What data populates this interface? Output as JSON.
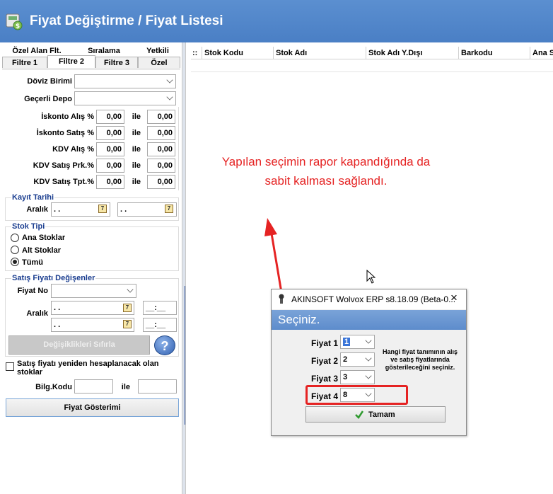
{
  "window": {
    "title": "Fiyat Değiştirme / Fiyat Listesi"
  },
  "left_panel": {
    "tabs_row1": [
      "Özel Alan Flt.",
      "Sıralama",
      "Yetkili"
    ],
    "tabs_row2": [
      "Filtre 1",
      "Filtre 2",
      "Filtre 3",
      "Özel"
    ],
    "active_tab": "Filtre 2",
    "doviz_birimi_label": "Döviz Birimi",
    "gecerli_depo_label": "Geçerli Depo",
    "ile_label": "ile",
    "rows": [
      {
        "label": "İskonto Alış %",
        "from": "0,00",
        "to": "0,00"
      },
      {
        "label": "İskonto Satış %",
        "from": "0,00",
        "to": "0,00"
      },
      {
        "label": "KDV Alış %",
        "from": "0,00",
        "to": "0,00"
      },
      {
        "label": "KDV Satış Prk.%",
        "from": "0,00",
        "to": "0,00"
      },
      {
        "label": "KDV Satış Tpt.%",
        "from": "0,00",
        "to": "0,00"
      }
    ],
    "kayit_tarihi": {
      "title": "Kayıt Tarihi",
      "aralik_label": "Aralık",
      "from": ". .",
      "to": ". ."
    },
    "stok_tipi": {
      "title": "Stok Tipi",
      "options": [
        "Ana Stoklar",
        "Alt Stoklar",
        "Tümü"
      ],
      "selected": "Tümü"
    },
    "satis_fiyati": {
      "title": "Satış Fiyatı Değişenler",
      "fiyat_no_label": "Fiyat No",
      "aralik_label": "Aralık",
      "date_from": ". .",
      "date_to": ". .",
      "time_from": "__:__",
      "time_to": "__:__",
      "reset_button": "Değişiklikleri Sıfırla",
      "help_icon_text": "?"
    },
    "recalc_checkbox_label": "Satış fiyatı yeniden hesaplanacak olan stoklar",
    "bilg_kodu_label": "Bilg.Kodu",
    "show_prices_button": "Fiyat Gösterimi"
  },
  "grid": {
    "corner": "::",
    "columns": [
      "Stok Kodu",
      "Stok Adı",
      "Stok Adı Y.Dışı",
      "Barkodu",
      "Ana S"
    ]
  },
  "annotation": {
    "line1": "Yapılan seçimin rapor kapandığında da",
    "line2": "sabit kalması sağlandı.",
    "color": "#e52323"
  },
  "dialog": {
    "title": "AKINSOFT Wolvox ERP s8.18.09 (Beta-0...",
    "close_icon": "×",
    "banner": "Seçiniz.",
    "fields": [
      {
        "label": "Fiyat 1",
        "value": "1"
      },
      {
        "label": "Fiyat 2",
        "value": "2"
      },
      {
        "label": "Fiyat 3",
        "value": "3"
      },
      {
        "label": "Fiyat 4",
        "value": "8"
      }
    ],
    "info_text": "Hangi fiyat tanımının alış ve satış fiyatlarında gösterileceğini seçiniz.",
    "ok_button": "Tamam"
  },
  "colors": {
    "title_bar": "#4a7fc5",
    "group_title": "#1a3d8f",
    "highlight": "#e52323"
  }
}
